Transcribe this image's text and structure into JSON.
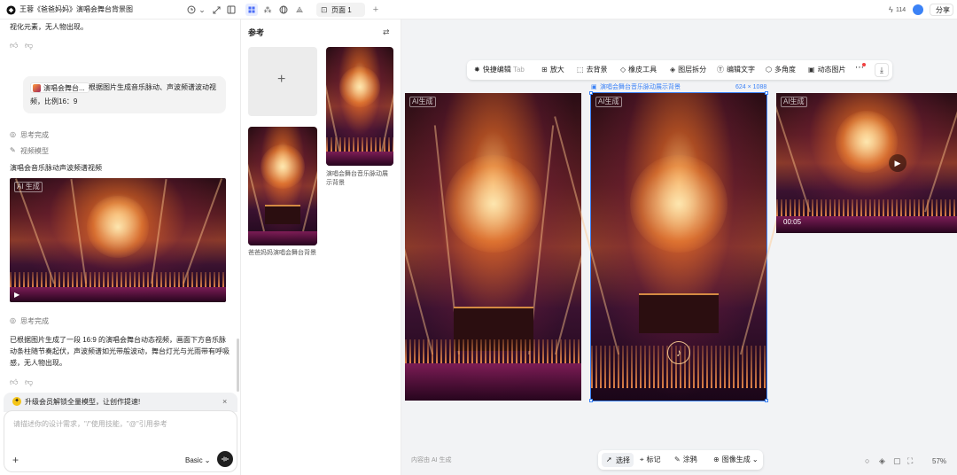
{
  "topbar": {
    "title": "王蓉《爸爸妈妈》演唱会舞台背景图",
    "page_tab": "页面 1",
    "credits": "114",
    "share": "分享"
  },
  "chat": {
    "line_top": "视化元素，无人物出现。",
    "request_chip": "演唱会舞台...",
    "request_text_1": "根据图片生成音乐脉动、声波频谱波动视",
    "request_text_2": "频，比例16：9",
    "thinking_1": "思考完成",
    "video_model": "视频模型",
    "result_title": "演唱会音乐脉动声波频谱视频",
    "ai_tag": "AI 生成",
    "thinking_2": "思考完成",
    "summary_1": "已根据图片生成了一段 16:9 的演唱会舞台动态视频，画面下方音乐脉",
    "summary_2": "动条柱随节奏起伏，声波频谱如光带般波动，舞台灯光与光雨带有呼吸",
    "summary_3": "感，无人物出现。",
    "promo": "升级会员解锁全量模型，让创作提速!",
    "input_placeholder": "请描述你的设计需求，\"/\"使用技能，\"@\"引用参考",
    "mode": "Basic"
  },
  "refs": {
    "title": "参考",
    "caption_right": "演唱会舞台音乐脉动展示背景",
    "caption_left": "爸爸妈妈演唱会舞台背景"
  },
  "canvas": {
    "tools": {
      "quick_edit": "快捷编辑",
      "quick_edit_key": "Tab",
      "upscale": "放大",
      "remove_bg": "去背景",
      "eraser": "橡皮工具",
      "layers": "图层拆分",
      "edit_text": "编辑文字",
      "multi_angle": "多角度",
      "motion": "动态图片"
    },
    "selected_label": "演唱会舞台音乐脉动展示背景",
    "selected_size": "624 × 1088",
    "ai_tag": "AI生成",
    "video_time": "00:05",
    "footer_note": "内容由 AI 生成",
    "bottom": {
      "select": "选择",
      "mark": "标记",
      "brush": "涂鸦",
      "gen": "图像生成"
    },
    "zoom": "57%"
  },
  "colors": {
    "accent": "#3b82f6",
    "promo_star": "#f5c518"
  }
}
